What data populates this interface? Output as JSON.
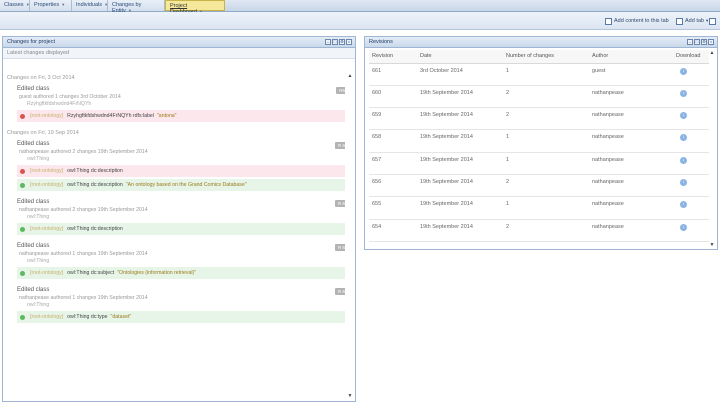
{
  "tabs": [
    {
      "label": "Classes",
      "active": false
    },
    {
      "label": "Properties",
      "active": false
    },
    {
      "label": "Individuals",
      "active": false
    },
    {
      "label": "Changes by Entity",
      "active": false
    },
    {
      "label": "Project Dashboard",
      "active": true
    }
  ],
  "toolbar": {
    "add_content_label": "Add content to this tab",
    "add_tab_label": "Add tab"
  },
  "left_panel": {
    "title": "Changes for project",
    "subheader": "Latest changes displayed",
    "groups": [
      {
        "date": "Changes on Fri, 3 Oct 2014",
        "entries": [
          {
            "title": "Edited class",
            "badge": "R661",
            "meta": "guest authored 1 changes 3rd October 2014",
            "sub": "Rzyhgftkfdshwdnd4FrNQYh",
            "changes": [
              {
                "type": "rem",
                "onto": "[root-ontology]",
                "prop": "Rzyhgftkfdshwdnd4FrNQYh rdfs:label",
                "val": "\"antona\""
              }
            ]
          }
        ]
      },
      {
        "date": "Changes on Fri, 19 Sep 2014",
        "entries": [
          {
            "title": "Edited class",
            "badge": "R 660",
            "meta": "nathanpease authored 2 changes 19th September 2014",
            "sub": "owl:Thing",
            "changes": [
              {
                "type": "rem",
                "onto": "[root-ontology]",
                "prop": "owl:Thing dc:description",
                "val": ""
              },
              {
                "type": "add",
                "onto": "[root-ontology]",
                "prop": "owl:Thing dc:description",
                "val": "\"An ontology based on the Grand Comics Database\""
              }
            ]
          },
          {
            "title": "Edited class",
            "badge": "R 659",
            "meta": "nathanpease authored 2 changes 19th September 2014",
            "sub": "owl:Thing",
            "changes": [
              {
                "type": "add",
                "onto": "[root-ontology]",
                "prop": "owl:Thing dc:description",
                "val": ""
              }
            ]
          },
          {
            "title": "Edited class",
            "badge": "R 658",
            "meta": "nathanpease authored 1 changes 19th September 2014",
            "sub": "owl:Thing",
            "changes": [
              {
                "type": "add",
                "onto": "[root-ontology]",
                "prop": "owl:Thing dc:subject",
                "val": "\"Ontologies (information retrieval)\""
              }
            ]
          },
          {
            "title": "Edited class",
            "badge": "R 657",
            "meta": "nathanpease authored 1 changes 19th September 2014",
            "sub": "owl:Thing",
            "changes": [
              {
                "type": "add",
                "onto": "[root-ontology]",
                "prop": "owl:Thing dc:type",
                "val": "\"dataset\""
              }
            ]
          }
        ]
      }
    ]
  },
  "right_panel": {
    "title": "Revisions",
    "columns": [
      "Revision",
      "Date",
      "Number of changes",
      "Author",
      "Download"
    ],
    "rows": [
      {
        "revision": "661",
        "date": "3rd October 2014",
        "changes": "1",
        "author": "guest"
      },
      {
        "revision": "660",
        "date": "19th September 2014",
        "changes": "2",
        "author": "nathanpease"
      },
      {
        "revision": "659",
        "date": "19th September 2014",
        "changes": "2",
        "author": "nathanpease"
      },
      {
        "revision": "658",
        "date": "19th September 2014",
        "changes": "1",
        "author": "nathanpease"
      },
      {
        "revision": "657",
        "date": "19th September 2014",
        "changes": "1",
        "author": "nathanpease"
      },
      {
        "revision": "656",
        "date": "19th September 2014",
        "changes": "2",
        "author": "nathanpease"
      },
      {
        "revision": "655",
        "date": "19th September 2014",
        "changes": "1",
        "author": "nathanpease"
      },
      {
        "revision": "654",
        "date": "19th September 2014",
        "changes": "2",
        "author": "nathanpease"
      }
    ]
  },
  "icons": {
    "tab_menu": "chevron-down-icon",
    "panel_tools": [
      "minimize-icon",
      "maximize-icon",
      "settings-icon",
      "close-icon"
    ],
    "download": "download-icon",
    "scroll_up": "arrow-up-icon",
    "scroll_down": "arrow-down-icon"
  }
}
